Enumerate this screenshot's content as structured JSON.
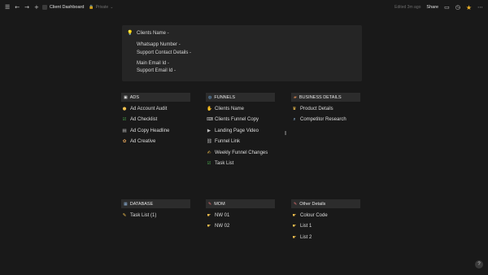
{
  "topbar": {
    "page_title": "Client Dashboard",
    "privacy": "Private",
    "edited": "Edited 3m ago",
    "share": "Share"
  },
  "callout": {
    "lines": [
      "Clients Name -",
      "Whatsapp Number -",
      "Support Contact Details -",
      "Main Email Id -",
      "Support Email Id -"
    ]
  },
  "sections": {
    "ads": {
      "title": "ADS",
      "icon": "ads-icon",
      "items": [
        "Ad Account Audit",
        "Ad Checklist",
        "Ad Copy Headline",
        "Ad Creative"
      ]
    },
    "funnels": {
      "title": "FUNNELS",
      "icon": "globe-icon",
      "items": [
        "Clients Name",
        "Clients Funnel Copy",
        "Landing Page Video",
        "Funnel Link",
        "Weekly Funnel Changes",
        "Task List"
      ]
    },
    "business": {
      "title": "BUSINESS DETAILS",
      "icon": "briefcase-icon",
      "items": [
        "Product Details",
        "Competitor Research"
      ]
    },
    "database": {
      "title": "DATABASE",
      "icon": "database-icon",
      "items": [
        "Task List (1)"
      ]
    },
    "mom": {
      "title": "MOM",
      "icon": "pencil-icon",
      "items": [
        "NW 01",
        "NW 02"
      ]
    },
    "other": {
      "title": "Other Details",
      "icon": "pencil-icon",
      "items": [
        "Colour Code",
        "List 1",
        "List 2"
      ]
    }
  },
  "colors": {
    "background": "#191919",
    "header": "#2c2c2c",
    "callout": "#252525",
    "star": "#f0b429"
  }
}
